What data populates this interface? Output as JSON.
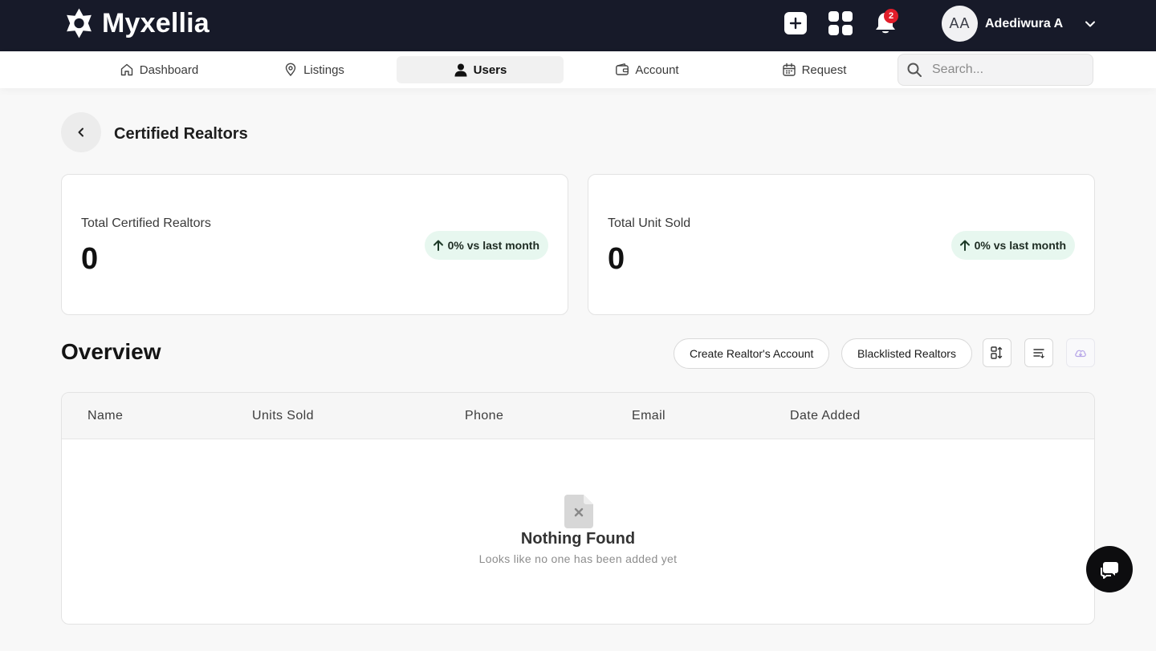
{
  "brand": {
    "name": "Myxellia"
  },
  "topbar": {
    "notification_count": "2",
    "user": {
      "initials": "AA",
      "name": "Adediwura A"
    }
  },
  "nav": {
    "items": [
      {
        "label": "Dashboard",
        "icon": "home-icon"
      },
      {
        "label": "Listings",
        "icon": "map-pin-icon"
      },
      {
        "label": "Users",
        "icon": "user-icon",
        "active": true
      },
      {
        "label": "Account",
        "icon": "wallet-icon"
      },
      {
        "label": "Request",
        "icon": "calendar-icon"
      }
    ],
    "search_placeholder": "Search..."
  },
  "page": {
    "title": "Certified Realtors"
  },
  "stats": [
    {
      "label": "Total Certified Realtors",
      "value": "0",
      "change": "0% vs last month"
    },
    {
      "label": "Total Unit Sold",
      "value": "0",
      "change": "0% vs last month"
    }
  ],
  "overview": {
    "title": "Overview",
    "create_button": "Create Realtor's Account",
    "blacklisted_button": "Blacklisted Realtors"
  },
  "table": {
    "columns": [
      "Name",
      "Units Sold",
      "Phone",
      "Email",
      "Date Added"
    ],
    "rows": [],
    "empty_title": "Nothing Found",
    "empty_subtitle": "Looks like no one has been added yet"
  },
  "colors": {
    "topbar_bg": "#171a29",
    "badge_red": "#e11d2a",
    "pill_green_bg": "#e7f7ef"
  }
}
